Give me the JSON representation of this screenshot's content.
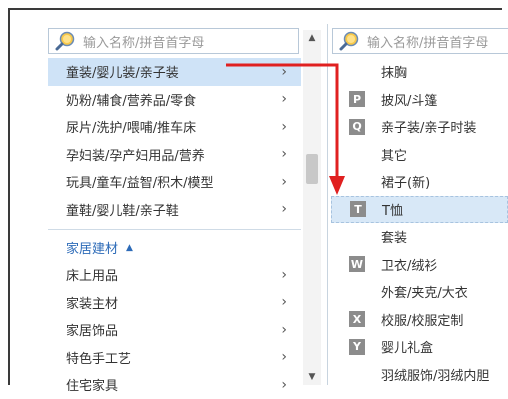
{
  "left_panel": {
    "search_placeholder": "输入名称/拼音首字母",
    "items": [
      {
        "label": "童装/婴儿装/亲子装",
        "selected": true
      },
      {
        "label": "奶粉/辅食/营养品/零食"
      },
      {
        "label": "尿片/洗护/喂哺/推车床"
      },
      {
        "label": "孕妇装/孕产妇用品/营养"
      },
      {
        "label": "玩具/童车/益智/积木/模型"
      },
      {
        "label": "童鞋/婴儿鞋/亲子鞋"
      }
    ],
    "group_label": "家居建材",
    "group_items": [
      {
        "label": "床上用品"
      },
      {
        "label": "家装主材"
      },
      {
        "label": "家居饰品"
      },
      {
        "label": "特色手工艺"
      },
      {
        "label": "住宅家具"
      }
    ],
    "chevron": "›"
  },
  "right_panel": {
    "search_placeholder": "输入名称/拼音首字母",
    "items": [
      {
        "badge": "",
        "label": "抹胸"
      },
      {
        "badge": "P",
        "label": "披风/斗篷"
      },
      {
        "badge": "Q",
        "label": "亲子装/亲子时装"
      },
      {
        "badge": "",
        "label": "其它"
      },
      {
        "badge": "",
        "label": "裙子(新)"
      },
      {
        "badge": "T",
        "label": "T恤",
        "selected": true
      },
      {
        "badge": "",
        "label": "套装"
      },
      {
        "badge": "W",
        "label": "卫衣/绒衫"
      },
      {
        "badge": "",
        "label": "外套/夹克/大衣"
      },
      {
        "badge": "X",
        "label": "校服/校服定制"
      },
      {
        "badge": "Y",
        "label": "婴儿礼盒"
      },
      {
        "badge": "",
        "label": "羽绒服饰/羽绒内胆"
      }
    ]
  },
  "colors": {
    "arrow": "#e02020",
    "selected_bg": "#cfe3f7",
    "group_link": "#2d6bb8"
  }
}
